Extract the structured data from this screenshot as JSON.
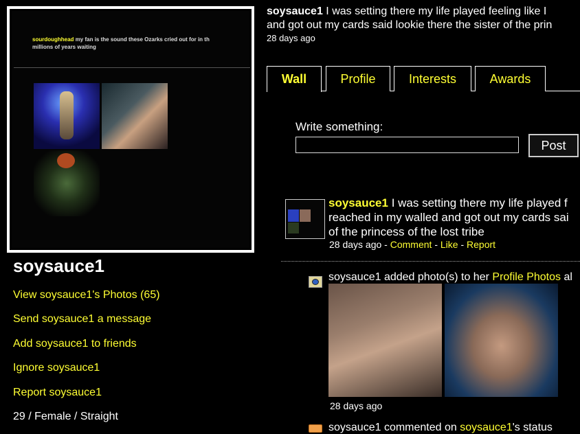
{
  "profile_picture": {
    "caption_user": "sourdoughhead",
    "caption_text": "my fan is the sound these Ozarks cried out for in th",
    "caption_line2": "millions of years waiting"
  },
  "sidebar": {
    "username": "soysauce1",
    "links": [
      "View soysauce1's Photos (65)",
      "Send soysauce1 a message",
      "Add soysauce1 to friends",
      "Ignore soysauce1",
      "Report soysauce1"
    ],
    "info": "29 / Female / Straight"
  },
  "status": {
    "user": "soysauce1",
    "text": "I was setting there my life played feeling like I",
    "text_line2": "and got out my cards said lookie there the sister of the prin",
    "time": "28 days ago"
  },
  "tabs": [
    "Wall",
    "Profile",
    "Interests",
    "Awards"
  ],
  "write": {
    "label": "Write something:",
    "value": "",
    "post_label": "Post"
  },
  "wall_post": {
    "user": "soysauce1",
    "line1": "I was setting there my life played f",
    "line2": "reached in my walled and got out my cards sai",
    "line3": "of the princess of the lost tribe",
    "time": "28 days ago",
    "sep1": " - ",
    "comment": "Comment",
    "sep2": " - ",
    "like": "Like",
    "sep3": " - ",
    "report": "Report"
  },
  "activity": [
    {
      "pre": "soysauce1 added photo(s) to her",
      "link": "Profile Photos",
      "post": "al",
      "time": "28 days ago"
    },
    {
      "pre": "soysauce1 commented on",
      "link": "soysauce1",
      "post": "'s status"
    }
  ],
  "colors": {
    "link": "#ffff33",
    "background": "#000000",
    "text": "#ffffff"
  }
}
